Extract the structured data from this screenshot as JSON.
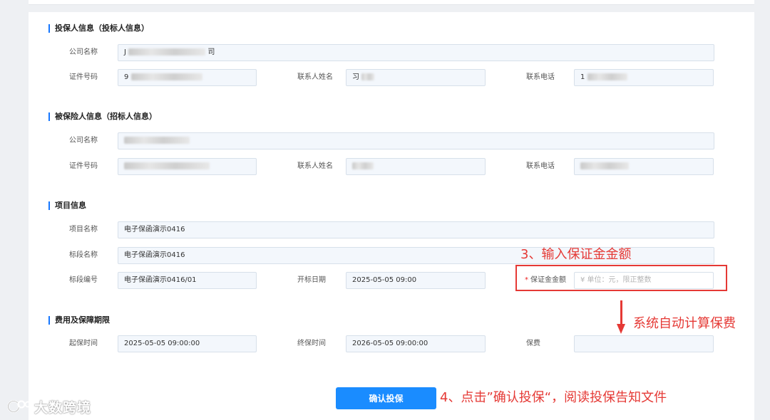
{
  "sections": {
    "applicant": {
      "title": "投保人信息（投标人信息）",
      "company_label": "公司名称",
      "id_label": "证件号码",
      "contact_label": "联系人姓名",
      "phone_label": "联系电话",
      "company_value_prefix": "J",
      "company_value_suffix": "司",
      "id_value_prefix": "9",
      "contact_value_prefix": "习",
      "phone_value_prefix": "1"
    },
    "insured": {
      "title": "被保险人信息（招标人信息）",
      "company_label": "公司名称",
      "id_label": "证件号码",
      "contact_label": "联系人姓名",
      "phone_label": "联系电话"
    },
    "project": {
      "title": "项目信息",
      "project_name_label": "项目名称",
      "project_name_value": "电子保函演示0416",
      "section_name_label": "标段名称",
      "section_name_value": "电子保函演示0416",
      "section_no_label": "标段编号",
      "section_no_value": "电子保函演示0416/01",
      "open_date_label": "开标日期",
      "open_date_value": "2025-05-05 09:00",
      "deposit_label": "保证金金额",
      "deposit_required_mark": "*",
      "deposit_placeholder": "¥ 单位：元，限正整数"
    },
    "fee": {
      "title": "费用及保障期限",
      "start_label": "起保时间",
      "start_value": "2025-05-05 09:00:00",
      "end_label": "终保时间",
      "end_value": "2026-05-05 09:00:00",
      "premium_label": "保费",
      "premium_value": ""
    }
  },
  "actions": {
    "confirm_label": "确认投保"
  },
  "annotations": {
    "step3": "3、输入保证金金额",
    "auto_calc": "系统自动计算保费",
    "step4": "4、点击”确认投保“，阅读投保告知文件"
  },
  "watermark": {
    "text": "大数跨境"
  },
  "colors": {
    "accent": "#1a8cff",
    "annotation_red": "#e53935",
    "field_bg": "#f3f7fc"
  }
}
